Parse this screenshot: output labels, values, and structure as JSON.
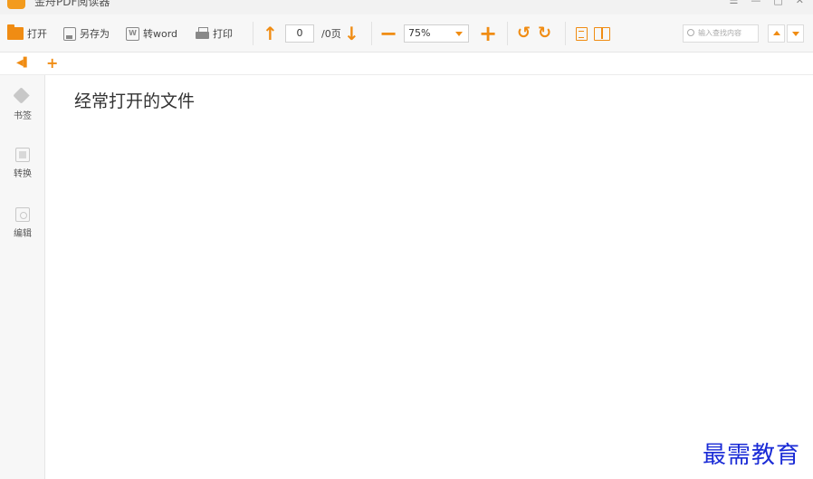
{
  "window": {
    "title": "金舟PDF阅读器",
    "controls": [
      "☰",
      "—",
      "□",
      "✕"
    ]
  },
  "toolbar": {
    "open_label": "打开",
    "save_as_label": "另存为",
    "to_word_label": "转word",
    "print_label": "打印",
    "page_value": "0",
    "page_suffix": "/0页",
    "zoom_value": "75%",
    "search_placeholder": "输入查找内容"
  },
  "tabs": {
    "collapse_glyph": "◀▌",
    "add_glyph": "+"
  },
  "sidebar": {
    "items": [
      {
        "label": "书签",
        "icon": "bookmark-tag-icon"
      },
      {
        "label": "转换",
        "icon": "convert-icon"
      },
      {
        "label": "编辑",
        "icon": "edit-icon"
      }
    ]
  },
  "main": {
    "heading": "经常打开的文件",
    "recent_files": []
  },
  "watermark": {
    "text": "最需教育"
  },
  "colors": {
    "accent": "#f08c13",
    "watermark": "#1a2bd6"
  }
}
